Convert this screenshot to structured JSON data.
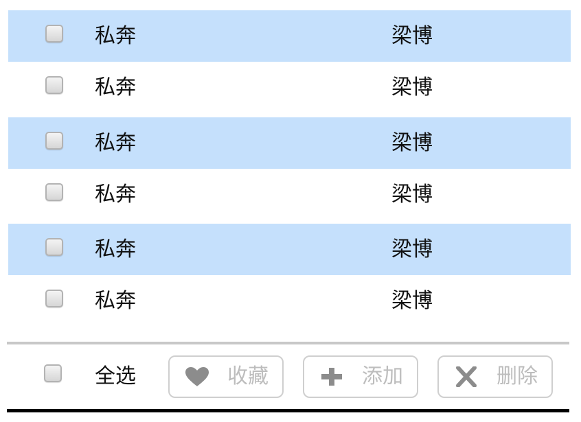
{
  "songs": [
    {
      "title": "私奔",
      "artist": "梁博",
      "checked": false,
      "highlighted": true
    },
    {
      "title": "私奔",
      "artist": "梁博",
      "checked": false,
      "highlighted": false
    },
    {
      "title": "私奔",
      "artist": "梁博",
      "checked": false,
      "highlighted": true
    },
    {
      "title": "私奔",
      "artist": "梁博",
      "checked": false,
      "highlighted": false
    },
    {
      "title": "私奔",
      "artist": "梁博",
      "checked": false,
      "highlighted": true
    },
    {
      "title": "私奔",
      "artist": "梁博",
      "checked": false,
      "highlighted": false
    }
  ],
  "footer": {
    "select_all_label": "全选",
    "select_all_checked": false,
    "buttons": {
      "favorite": {
        "label": "收藏",
        "icon": "heart-icon"
      },
      "add": {
        "label": "添加",
        "icon": "plus-icon"
      },
      "delete": {
        "label": "删除",
        "icon": "close-icon"
      }
    }
  },
  "colors": {
    "highlight_row": "#c5e0fc",
    "button_disabled_text": "#bdbdbd",
    "icon_gray": "#8c8c8c"
  }
}
